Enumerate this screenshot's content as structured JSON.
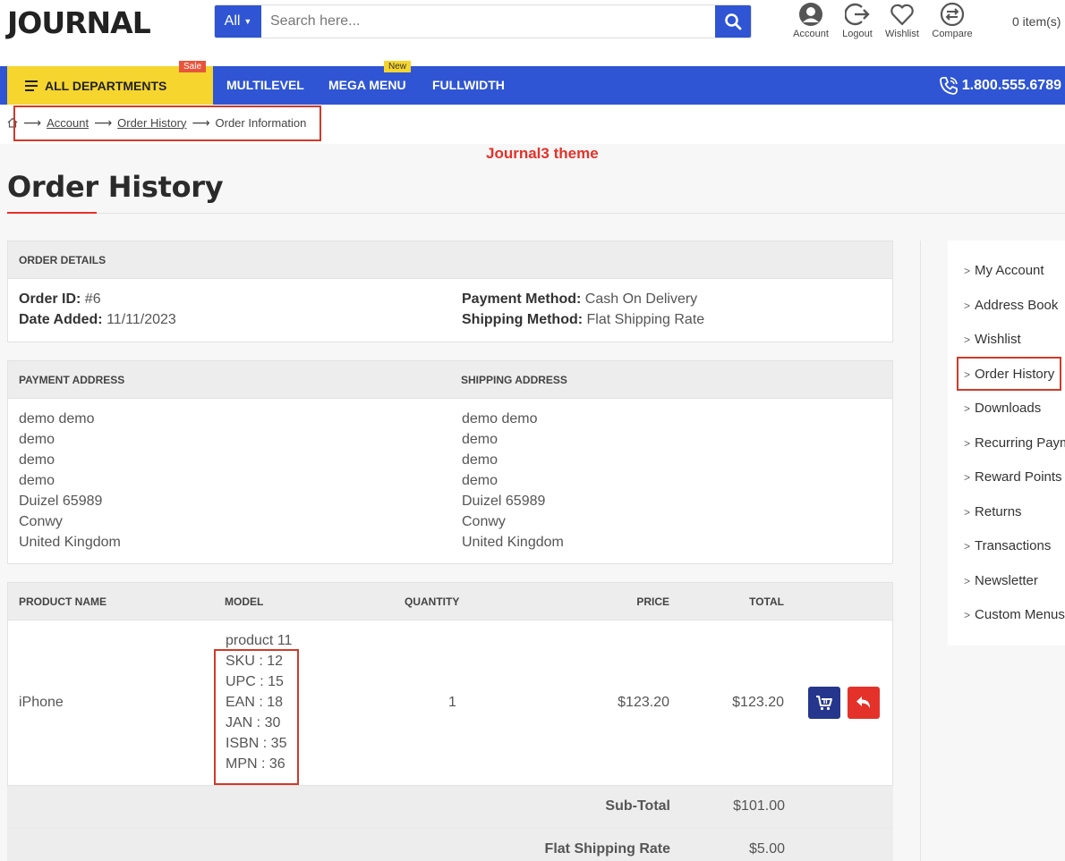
{
  "header": {
    "logo": "JOURNAL",
    "search": {
      "category": "All",
      "placeholder": "Search here..."
    },
    "icons": [
      {
        "label": "Account",
        "icon": "account-icon"
      },
      {
        "label": "Logout",
        "icon": "logout-icon"
      },
      {
        "label": "Wishlist",
        "icon": "heart-icon"
      },
      {
        "label": "Compare",
        "icon": "compare-icon"
      }
    ],
    "cart": "0 item(s)"
  },
  "nav": {
    "departments": "ALL DEPARTMENTS",
    "sale_tag": "Sale",
    "new_tag": "New",
    "links": [
      "MULTILEVEL",
      "MEGA MENU",
      "FULLWIDTH"
    ],
    "phone": "1.800.555.6789",
    "colors": {
      "bar": "#2f55d4",
      "departments": "#f5d52e"
    }
  },
  "breadcrumb": {
    "items": [
      "Account",
      "Order History",
      "Order Information"
    ]
  },
  "annotation": "Journal3 theme",
  "page_title": "Order History",
  "order_details": {
    "heading": "ORDER DETAILS",
    "order_id_label": "Order ID:",
    "order_id": "#6",
    "date_label": "Date Added:",
    "date": "11/11/2023",
    "payment_method_label": "Payment Method:",
    "payment_method": "Cash On Delivery",
    "shipping_method_label": "Shipping Method:",
    "shipping_method": "Flat Shipping Rate"
  },
  "addresses": {
    "payment_heading": "PAYMENT ADDRESS",
    "shipping_heading": "SHIPPING ADDRESS",
    "payment": [
      "demo demo",
      "demo",
      "demo",
      "demo",
      "Duizel 65989",
      "Conwy",
      "United Kingdom"
    ],
    "shipping": [
      "demo demo",
      "demo",
      "demo",
      "demo",
      "Duizel 65989",
      "Conwy",
      "United Kingdom"
    ]
  },
  "products": {
    "headers": {
      "name": "PRODUCT NAME",
      "model": "MODEL",
      "quantity": "QUANTITY",
      "price": "PRICE",
      "total": "TOTAL"
    },
    "rows": [
      {
        "name": "iPhone",
        "model": "product 11",
        "attributes": [
          "SKU : 12",
          "UPC : 15",
          "EAN : 18",
          "JAN : 30",
          "ISBN : 35",
          "MPN : 36"
        ],
        "quantity": "1",
        "price": "$123.20",
        "total": "$123.20"
      }
    ],
    "totals": [
      {
        "label": "Sub-Total",
        "value": "$101.00"
      },
      {
        "label": "Flat Shipping Rate",
        "value": "$5.00"
      }
    ],
    "colors": {
      "reorder": "#25368c",
      "return": "#e4322a"
    }
  },
  "sidebar": {
    "items": [
      "My Account",
      "Address Book",
      "Wishlist",
      "Order History",
      "Downloads",
      "Recurring Payments",
      "Reward Points",
      "Returns",
      "Transactions",
      "Newsletter",
      "Custom Menus"
    ]
  }
}
